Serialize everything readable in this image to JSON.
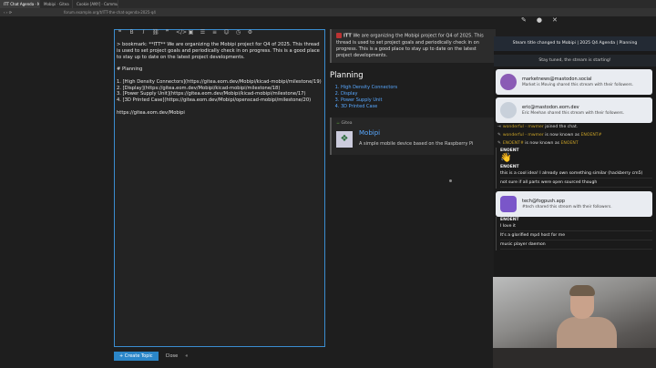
{
  "browser": {
    "tabs": [
      "ITT Chat Agenda · Mo",
      "Mobipi · Gitea",
      "Cookie [ANY] · Communi"
    ],
    "url": "forum.example.org/t/ITT-the-chat-agenda-2025-q4"
  },
  "editor": {
    "toolbar_icons": [
      "quote-icon",
      "bold-icon",
      "italic-icon",
      "link-icon",
      "blockquote-icon",
      "code-icon",
      "image-icon",
      "bullet-list-icon",
      "numbered-list-icon",
      "emoji-icon",
      "date-icon",
      "gear-icon"
    ],
    "lines": [
      "> bookmark: **ITT** We are organizing the Mobipi project for Q4 of 2025. This thread is used to set project goals and periodically check in on progress.  This is a good place to stay up to date on the latest project developments.",
      "",
      "# Planning",
      "",
      "1. [High Density Connectors](https://gitea.eom.dev/Mobipi/kicad-mobipi/milestone/19)",
      "2. [Display](https://gitea.eom.dev/Mobipi/kicad-mobipi/milestone/18)",
      "3. [Power Supply Unit](https://gitea.eom.dev/Mobipi/kicad-mobipi/milestone/17)",
      "4. [3D Printed Case](https://gitea.eom.dev/Mobipi/openscad-mobipi/milestone/20)",
      "",
      "https://gitea.eom.dev/Mobipi"
    ],
    "create_button": "+ Create Topic",
    "close_label": "Close",
    "collapse_icon": "«"
  },
  "preview": {
    "quote_prefix": "ITT",
    "quote_text": " We are organizing the Mobipi project for Q4 of 2025. This thread is used to set project goals and periodically check in on progress. This is a good place to stay up to date on the latest project developments.",
    "heading": "Planning",
    "items": [
      "High Density Connectors",
      "Display",
      "Power Supply Unit",
      "3D Printed Case"
    ],
    "onebox": {
      "source": "Gitea",
      "title": "Mobipi",
      "description": "A simple mobile device based on the Raspberry Pi"
    }
  },
  "chat": {
    "banner": "Steam title changed to Mobipi | 2025 Q4 Agenda | Planning",
    "banner2": "Stay tuned, the stream is starting!",
    "cards": [
      {
        "handle": "marketnews@mastodon.social",
        "text": "Market is Moving shared this stream with their followers.",
        "avatar_color": "#8a5bb5"
      },
      {
        "handle": "eric@mastodon.eom.dev",
        "text": "Eric Meehan shared this stream with their followers.",
        "avatar_color": "#c8d0da"
      }
    ],
    "sys1": {
      "name": "wonderful - mwmer",
      "text": "joined the chat."
    },
    "sys2": {
      "name": "wonderful - mwmer",
      "text": "is now known as ",
      "new": "ENOENT#"
    },
    "sys3": {
      "name": "ENOENT#",
      "text": "is now known as ",
      "new": "ENOENT"
    },
    "author1": "ENOENT",
    "wave": "👋",
    "author2": "ENOENT",
    "msg2a": "this is a cool idea! I already own something similar (hackberry cm5)",
    "msg2b": "not sure if all parts were open sourced though",
    "card3": {
      "handle": "tech@fogpush.app",
      "text": "#tech shared this stream with their followers.",
      "avatar_color": "#7a56c9"
    },
    "author3": "ENOENT",
    "msg3a": "I love it",
    "msg3b": "It's a glorified mpd host for me",
    "msg3c": "music player daemon"
  },
  "top_icons": [
    "pen-icon",
    "user-icon",
    "close-icon"
  ]
}
